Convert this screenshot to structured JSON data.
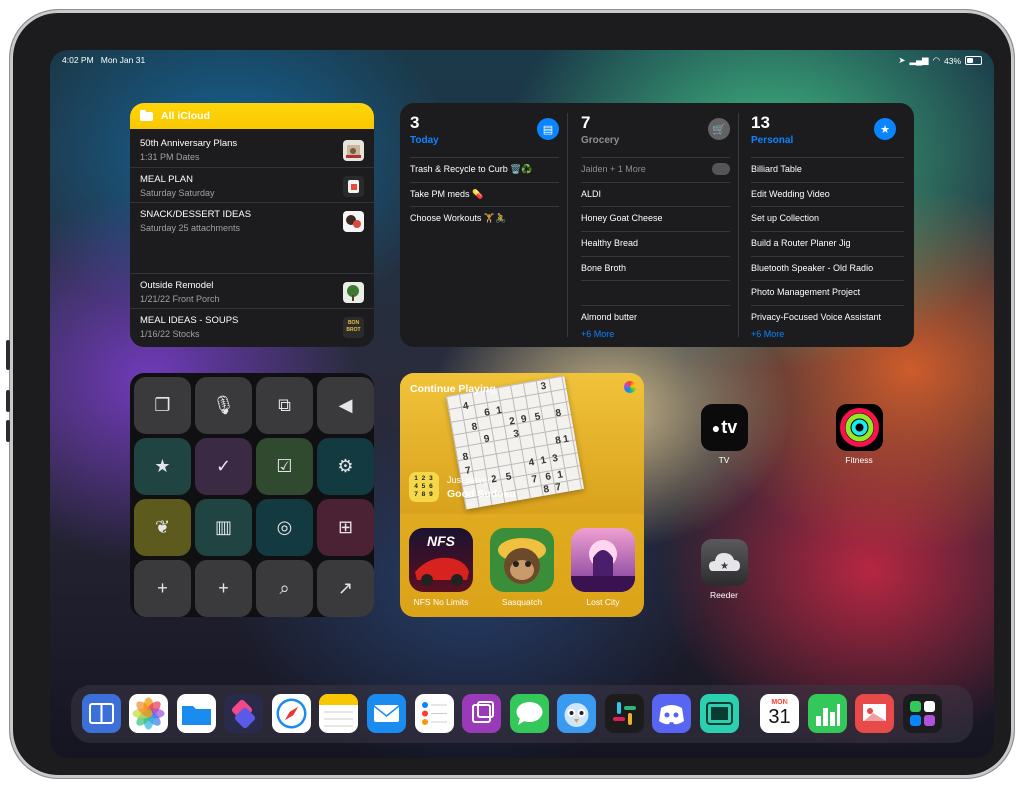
{
  "status_bar": {
    "time": "4:02 PM",
    "date": "Mon Jan 31",
    "battery": "43%"
  },
  "notes_widget": {
    "folder": "All iCloud",
    "notes": [
      {
        "title": "50th Anniversary Plans",
        "subtitle": "1:31 PM  Dates"
      },
      {
        "title": "MEAL PLAN",
        "subtitle": "Saturday  Saturday"
      },
      {
        "title": "SNACK/DESSERT IDEAS",
        "subtitle": "Saturday  25 attachments"
      },
      {
        "title": "Outside Remodel",
        "subtitle": "1/21/22  Front Porch"
      },
      {
        "title": "MEAL IDEAS - SOUPS",
        "subtitle": "1/16/22  Stocks",
        "thumb_text": "BON BROT"
      }
    ]
  },
  "reminders_widget": {
    "lists": [
      {
        "count": "3",
        "title": "Today",
        "color": "#0a84ff",
        "items": [
          "Trash & Recycle to Curb 🗑️♻️",
          "Take PM meds 💊",
          "Choose Workouts 🏋️🚴"
        ],
        "more": ""
      },
      {
        "count": "7",
        "title": "Grocery",
        "color": "#8e8e93",
        "items": [
          "Jaiden + 1 More",
          "ALDI",
          "Honey Goat Cheese",
          "Healthy Bread",
          "Bone Broth",
          "",
          "Almond butter"
        ],
        "more": "+6 More"
      },
      {
        "count": "13",
        "title": "Personal",
        "color": "#0a84ff",
        "items": [
          "Billiard Table",
          "Edit Wedding Video",
          "Set up Collection",
          "Build a Router Planer Jig",
          "Bluetooth Speaker - Old Radio",
          "Photo Management Project",
          "Privacy-Focused Voice Assistant"
        ],
        "more": "+6 More"
      }
    ]
  },
  "shortcuts_widget": {
    "buttons": [
      "clipboard-icon",
      "microphone-icon",
      "scan-text-icon",
      "play-back-icon",
      "calendar-star-icon",
      "calendar-check-icon",
      "checkbox-icon",
      "steam-icon",
      "leaf-icon",
      "library-icon",
      "steering-wheel-icon",
      "inbox-add-icon",
      "new-file-icon",
      "plus-icon",
      "search-icon",
      "arrow-out-icon"
    ],
    "colors": [
      "#3a3a3c",
      "#3a3a3c",
      "#3a3a3c",
      "#3a3a3c",
      "#1f4442",
      "#3b2a44",
      "#2f4a2e",
      "#123a40",
      "#5c5a1c",
      "#1f4442",
      "#123a40",
      "#4a2234",
      "#3a3a3c",
      "#3a3a3c",
      "#3a3a3c",
      "#3a3a3c"
    ],
    "glyphs": [
      "❐",
      "🎙",
      "⧉",
      "◀",
      "★",
      "✓",
      "☑",
      "⚙",
      "❦",
      "▥",
      "◎",
      "⊞",
      "+",
      "+",
      "⌕",
      "↗"
    ]
  },
  "games_widget": {
    "header": "Continue Playing",
    "just_played_label": "Just played",
    "game_title": "Good Sudoku",
    "icon_digits": "1 2 3 4 5 6 7 8 9",
    "games": [
      "NFS No Limits",
      "Sasquatch",
      "Lost City"
    ],
    "nfs_logo": "NFS"
  },
  "apps": [
    {
      "name": "TV",
      "glyph": "tv"
    },
    {
      "name": "Fitness"
    },
    {
      "name": "Reeder"
    }
  ],
  "dock": {
    "calendar_month": "MON",
    "calendar_day": "31",
    "icons": [
      "split-view-icon",
      "photos-icon",
      "files-icon",
      "shortcuts-icon",
      "safari-icon",
      "notes-icon",
      "mail-icon",
      "reminders-icon",
      "craft-icon",
      "messages-icon",
      "tweetbot-icon",
      "slack-icon",
      "discord-icon",
      "sidecar-icon",
      "calendar-icon",
      "numbers-icon",
      "slideshow-icon",
      "app-library-icon"
    ]
  }
}
